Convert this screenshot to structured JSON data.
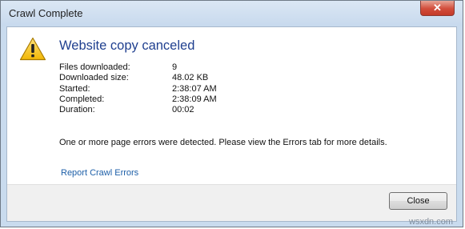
{
  "window": {
    "title": "Crawl Complete",
    "close_glyph": "✕"
  },
  "dialog": {
    "icon": "warning-icon",
    "heading": "Website copy canceled",
    "details": [
      {
        "label": "Files downloaded:",
        "value": "9"
      },
      {
        "label": "Downloaded size:",
        "value": "48.02 KB"
      },
      {
        "label": "Started:",
        "value": "2:38:07 AM"
      },
      {
        "label": "Completed:",
        "value": "2:38:09 AM"
      },
      {
        "label": "Duration:",
        "value": "00:02"
      }
    ],
    "message": "One or more page errors were detected. Please view the Errors tab for more details.",
    "link_text": "Report Crawl Errors",
    "close_button": "Close"
  },
  "watermark": "wsxdn.com",
  "colors": {
    "heading": "#1f3f8f",
    "link": "#1d5fa8",
    "warning_fill": "#f5c619",
    "close_x": "#d24d3b"
  }
}
